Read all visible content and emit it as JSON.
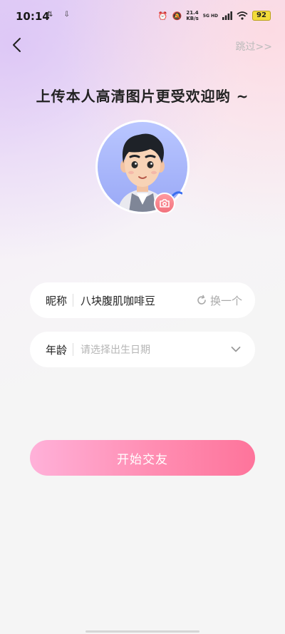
{
  "status_bar": {
    "time": "10:14",
    "left_icons": "⇅ ⇩",
    "speed_value": "21.4",
    "speed_unit": "KB/s",
    "network": "5G HD",
    "battery": "92"
  },
  "header": {
    "skip_label": "跳过>>",
    "title": "上传本人高清图片更受欢迎哟 ~"
  },
  "avatar": {
    "icon": "camera-icon",
    "accent_color": "#f2727d"
  },
  "form": {
    "nickname": {
      "label": "昵称",
      "value": "八块腹肌咖啡豆",
      "action_label": "换一个"
    },
    "age": {
      "label": "年龄",
      "placeholder": "请选择出生日期"
    }
  },
  "cta": {
    "label": "开始交友",
    "gradient_start": "#ffb1d9",
    "gradient_end": "#fe749b"
  }
}
